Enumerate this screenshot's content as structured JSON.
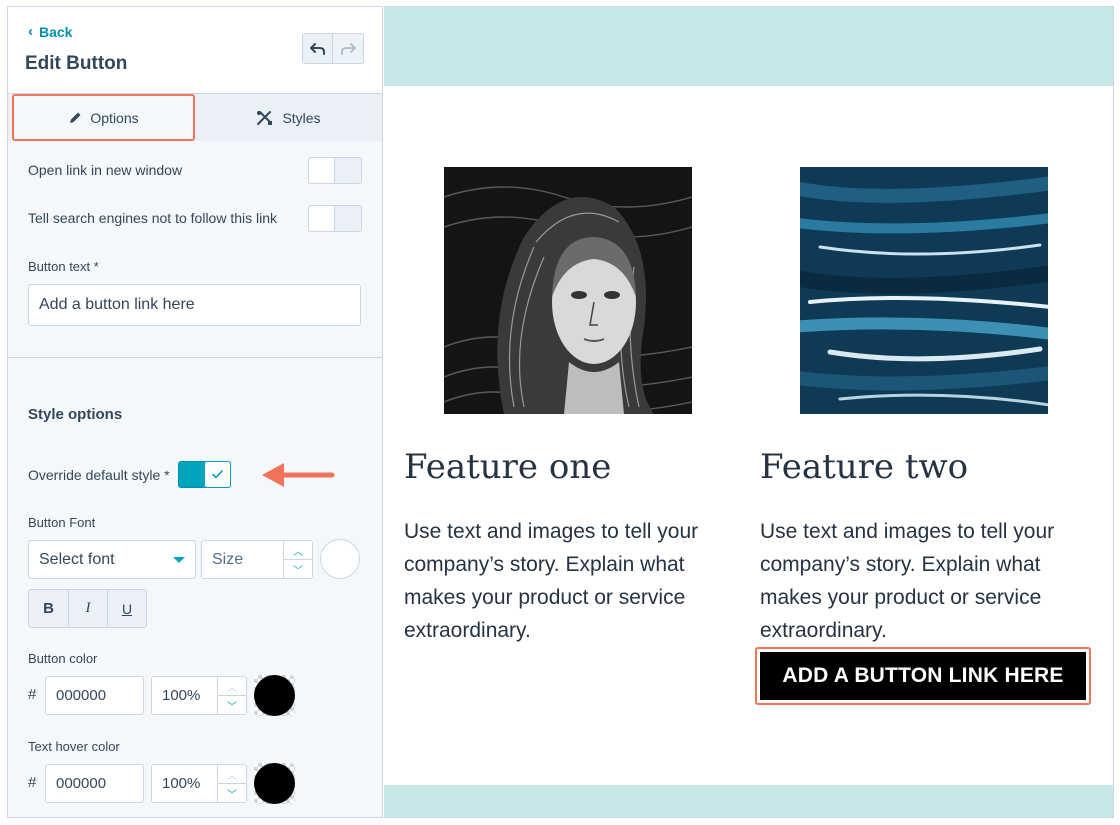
{
  "sidebar": {
    "back_label": "Back",
    "title": "Edit Button",
    "tabs": [
      {
        "label": "Options",
        "active": true
      },
      {
        "label": "Styles",
        "active": false
      }
    ],
    "open_new_window_label": "Open link in new window",
    "open_new_window_on": false,
    "nofollow_label": "Tell search engines not to follow this link",
    "nofollow_on": false,
    "button_text_label": "Button text *",
    "button_text_value": "Add a button link here",
    "style_options_title": "Style options",
    "override_label": "Override default style *",
    "override_on": true,
    "button_font_label": "Button Font",
    "font_select_value": "Select font",
    "size_placeholder": "Size",
    "style_buttons": [
      "B",
      "I",
      "U"
    ],
    "button_color_label": "Button color",
    "button_color": {
      "hash": "#",
      "hex": "000000",
      "opacity": "100%"
    },
    "text_hover_label": "Text hover color",
    "text_hover_color": {
      "hash": "#",
      "hex": "000000",
      "opacity": "100%"
    }
  },
  "preview": {
    "features": [
      {
        "title": "Feature one",
        "body": "Use text and images to tell your company’s story. Explain what makes your product or service extraordinary."
      },
      {
        "title": "Feature two",
        "body": "Use text and images to tell your company’s story. Explain what makes your product or service extraordinary."
      }
    ],
    "cta_label": "ADD A BUTTON LINK HERE"
  },
  "colors": {
    "accent": "#00a4bd",
    "highlight": "#f2735b",
    "band": "#c5e7e7",
    "text": "#33475b"
  }
}
